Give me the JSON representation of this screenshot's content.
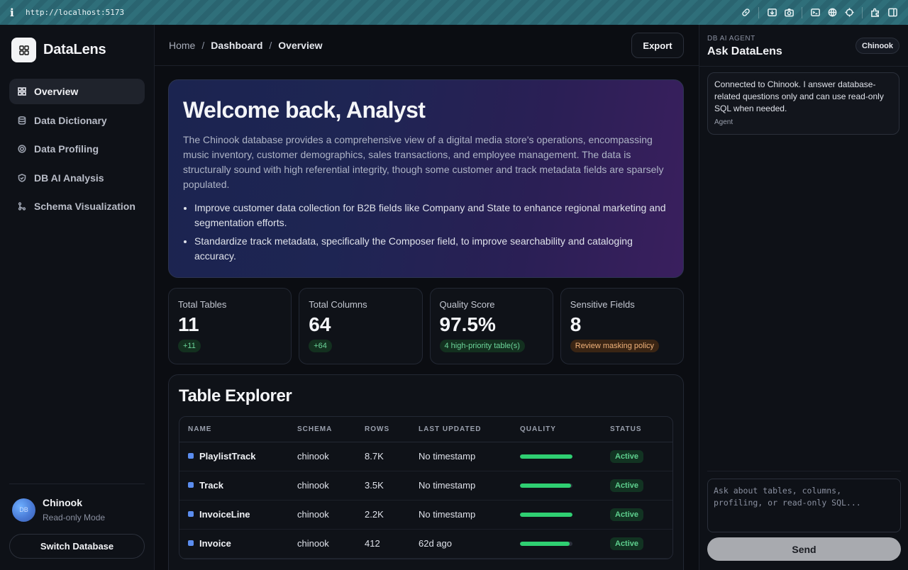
{
  "browser": {
    "url": "http://localhost:5173",
    "icons": [
      "link-icon",
      "download-icon",
      "camera-icon",
      "terminal-icon",
      "globe-icon",
      "crosshair-icon",
      "extension-icon",
      "sidebar-icon"
    ]
  },
  "sidebar": {
    "brand": "DataLens",
    "items": [
      {
        "label": "Overview",
        "icon": "grid-icon",
        "active": true
      },
      {
        "label": "Data Dictionary",
        "icon": "database-icon",
        "active": false
      },
      {
        "label": "Data Profiling",
        "icon": "target-icon",
        "active": false
      },
      {
        "label": "DB AI Analysis",
        "icon": "shield-icon",
        "active": false
      },
      {
        "label": "Schema Visualization",
        "icon": "schema-icon",
        "active": false
      }
    ],
    "db": {
      "name": "Chinook",
      "mode": "Read-only Mode",
      "avatar_text": "DB"
    },
    "switch_label": "Switch Database"
  },
  "header": {
    "crumbs": [
      "Home",
      "Dashboard",
      "Overview"
    ],
    "export_label": "Export"
  },
  "hero": {
    "title": "Welcome back, Analyst",
    "description": "The Chinook database provides a comprehensive view of a digital media store's operations, encompassing music inventory, customer demographics, sales transactions, and employee management. The data is structurally sound with high referential integrity, though some customer and track metadata fields are sparsely populated.",
    "bullets": [
      "Improve customer data collection for B2B fields like Company and State to enhance regional marketing and segmentation efforts.",
      "Standardize track metadata, specifically the Composer field, to improve searchability and cataloging accuracy."
    ]
  },
  "stats": [
    {
      "label": "Total Tables",
      "value": "11",
      "badge": "+11",
      "tone": "good"
    },
    {
      "label": "Total Columns",
      "value": "64",
      "badge": "+64",
      "tone": "good"
    },
    {
      "label": "Quality Score",
      "value": "97.5%",
      "badge": "4 high-priority table(s)",
      "tone": "good"
    },
    {
      "label": "Sensitive Fields",
      "value": "8",
      "badge": "Review masking policy",
      "tone": "warn"
    }
  ],
  "explorer": {
    "title": "Table Explorer",
    "columns": [
      "NAME",
      "SCHEMA",
      "ROWS",
      "LAST UPDATED",
      "QUALITY",
      "STATUS"
    ],
    "rows": [
      {
        "name": "PlaylistTrack",
        "schema": "chinook",
        "rows": "8.7K",
        "updated": "No timestamp",
        "quality": 1.0,
        "status": "Active"
      },
      {
        "name": "Track",
        "schema": "chinook",
        "rows": "3.5K",
        "updated": "No timestamp",
        "quality": 0.97,
        "status": "Active"
      },
      {
        "name": "InvoiceLine",
        "schema": "chinook",
        "rows": "2.2K",
        "updated": "No timestamp",
        "quality": 1.0,
        "status": "Active"
      },
      {
        "name": "Invoice",
        "schema": "chinook",
        "rows": "412",
        "updated": "62d ago",
        "quality": 0.95,
        "status": "Active"
      }
    ]
  },
  "agent": {
    "kicker": "DB AI AGENT",
    "title": "Ask DataLens",
    "chip": "Chinook",
    "message": "Connected to Chinook. I answer database-related questions only and can use read-only SQL when needed.",
    "message_author": "Agent",
    "input_placeholder": "Ask about tables, columns, profiling, or read-only SQL...",
    "send_label": "Send"
  }
}
